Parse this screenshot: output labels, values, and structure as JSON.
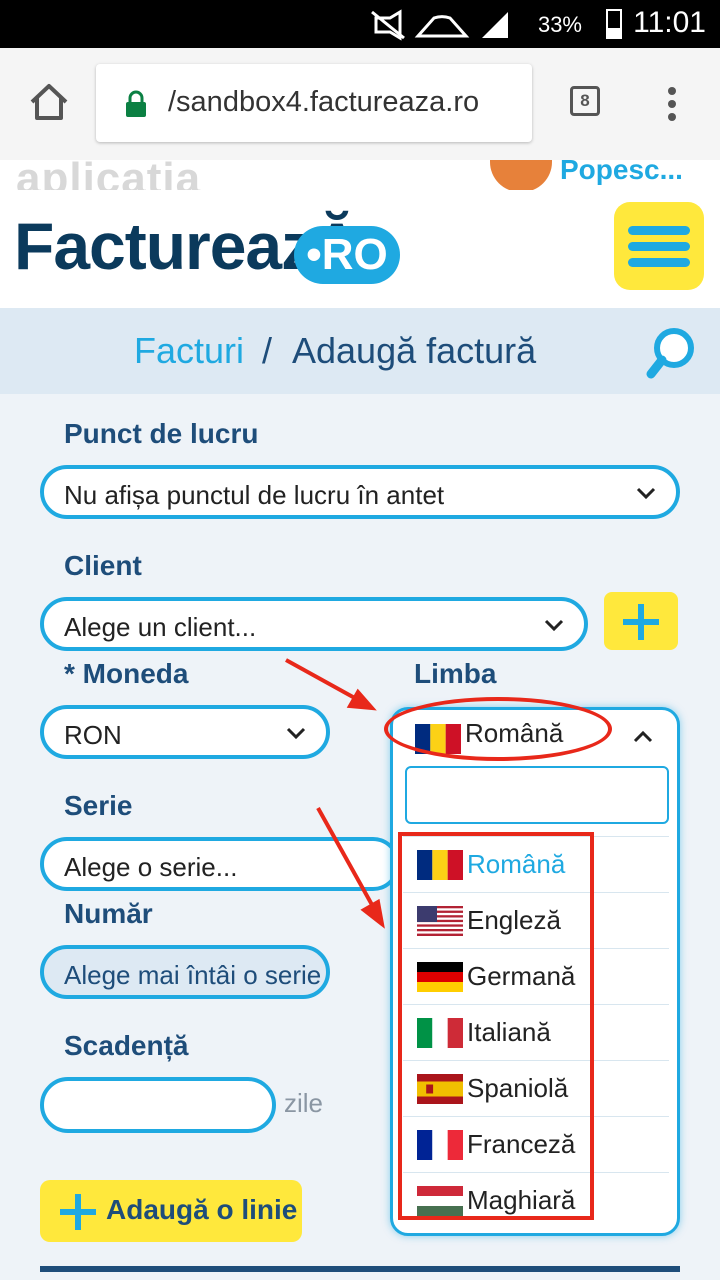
{
  "status_bar": {
    "battery": "33%",
    "time": "11:01"
  },
  "browser": {
    "url": "/sandbox4.factureaza.ro",
    "tab_count": "8"
  },
  "header": {
    "ghost_text": "aplicația",
    "logo": "FactureazĂ",
    "logo_badge": "•RO",
    "user_name": "Popesc..."
  },
  "breadcrumb": {
    "parent": "Facturi",
    "separator": "/",
    "current": "Adaugă factură"
  },
  "form": {
    "punct_label": "Punct de lucru",
    "punct_value": "Nu afișa punctul de lucru în antet",
    "client_label": "Client",
    "client_placeholder": "Alege un client...",
    "moneda_label": "* Moneda",
    "moneda_value": "RON",
    "limba_label": "Limba",
    "limba_value": "Română",
    "serie_label": "Serie",
    "serie_placeholder": "Alege o serie...",
    "numar_label": "Număr",
    "numar_placeholder": "Alege mai întâi o serie",
    "scadenta_label": "Scadență",
    "scadenta_value": "",
    "zile": "zile",
    "add_line": "Adaugă o linie"
  },
  "language_dropdown": {
    "search_value": "",
    "options": [
      {
        "label": "Română",
        "flag": "ro-flag",
        "selected": true
      },
      {
        "label": "Engleză",
        "flag": "us-flag",
        "selected": false
      },
      {
        "label": "Germană",
        "flag": "de-flag",
        "selected": false
      },
      {
        "label": "Italiană",
        "flag": "it-flag",
        "selected": false
      },
      {
        "label": "Spaniolă",
        "flag": "es-flag",
        "selected": false
      },
      {
        "label": "Franceză",
        "flag": "fr-flag",
        "selected": false
      },
      {
        "label": "Maghiară",
        "flag": "hu-flag",
        "selected": false
      }
    ]
  },
  "colors": {
    "accent": "#1fa9e1",
    "navy": "#1e4d7a",
    "yellow": "#ffe83c",
    "annotation": "#e8281a"
  }
}
